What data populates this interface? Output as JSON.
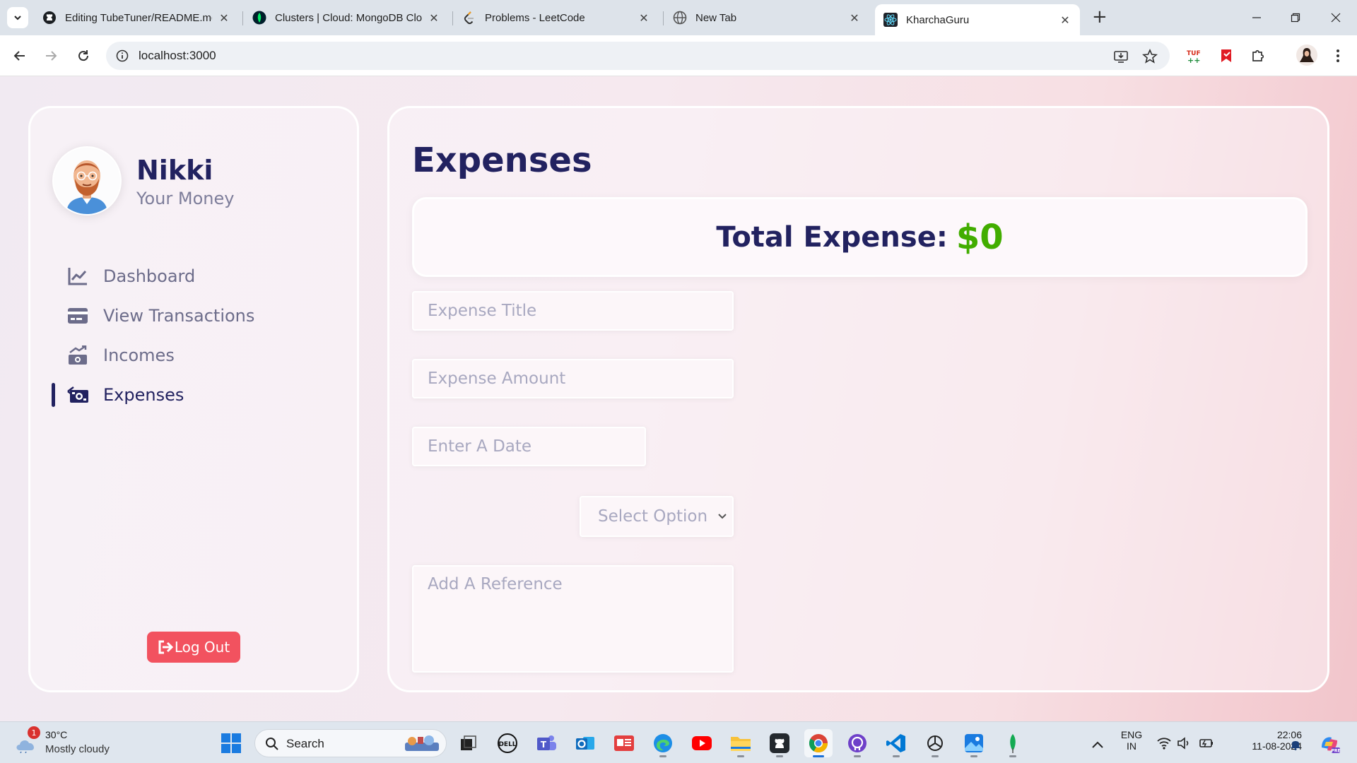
{
  "browser": {
    "tabs": [
      {
        "title": "Editing TubeTuner/README.md",
        "icon": "github-icon"
      },
      {
        "title": "Clusters | Cloud: MongoDB Cloud",
        "icon": "mongodb-icon"
      },
      {
        "title": "Problems - LeetCode",
        "icon": "leetcode-icon"
      },
      {
        "title": "New Tab",
        "icon": "globe-icon"
      },
      {
        "title": "KharchaGuru",
        "icon": "react-icon"
      }
    ],
    "active_tab": 4,
    "url": "localhost:3000"
  },
  "sidebar": {
    "user_name": "Nikki",
    "user_subtitle": "Your Money",
    "items": [
      {
        "label": "Dashboard",
        "icon": "chart-line-icon"
      },
      {
        "label": "View Transactions",
        "icon": "credit-card-icon"
      },
      {
        "label": "Incomes",
        "icon": "money-trend-icon"
      },
      {
        "label": "Expenses",
        "icon": "money-bill-icon"
      }
    ],
    "active_item": 3,
    "logout_label": "Log Out"
  },
  "main": {
    "title": "Expenses",
    "total_label": "Total Expense:",
    "total_value": "$0",
    "form": {
      "title_placeholder": "Expense Title",
      "amount_placeholder": "Expense Amount",
      "date_placeholder": "Enter A Date",
      "select_value": "Select Option",
      "reference_placeholder": "Add A Reference"
    }
  },
  "taskbar": {
    "weather_badge": "1",
    "weather_temp": "30°C",
    "weather_desc": "Mostly cloudy",
    "search_label": "Search",
    "lang_line1": "ENG",
    "lang_line2": "IN",
    "time": "22:06",
    "date": "11-08-2024"
  },
  "colors": {
    "accent": "#222260",
    "total_value": "#42ad00",
    "logout": "#f2525f"
  }
}
